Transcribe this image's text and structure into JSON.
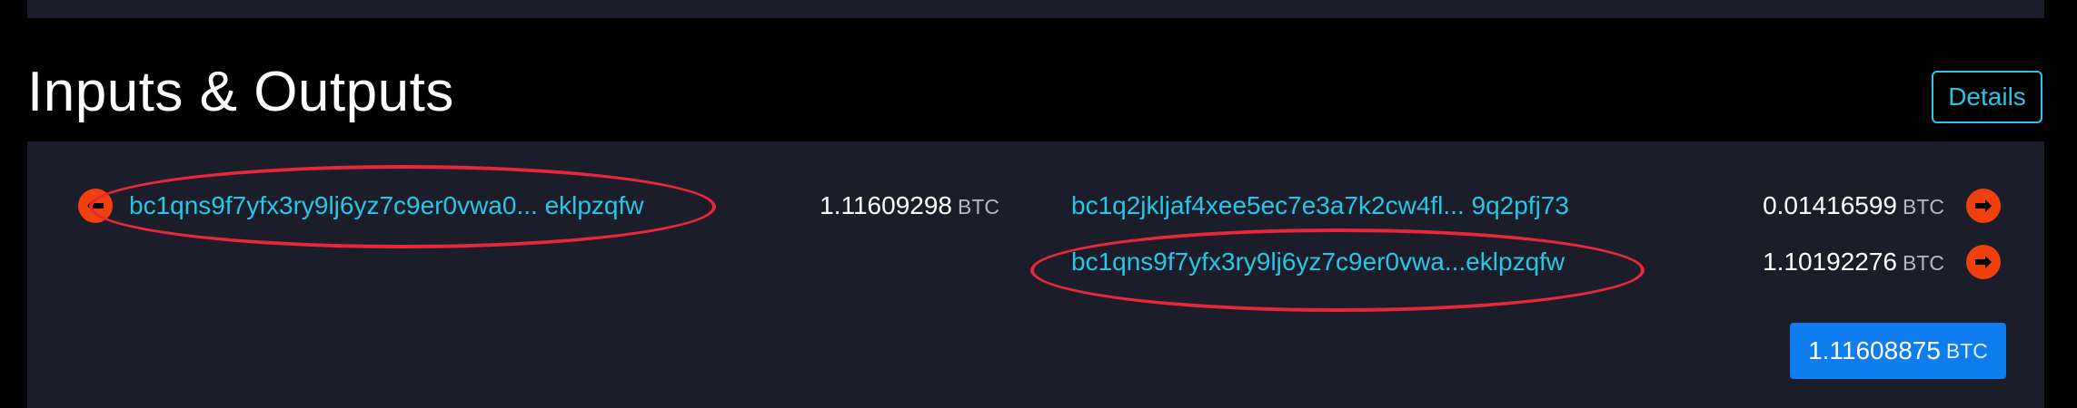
{
  "section": {
    "title": "Inputs & Outputs",
    "details_label": "Details"
  },
  "inputs": [
    {
      "address": "bc1qns9f7yfx3ry9lj6yz7c9er0vwa0... eklpzqfw",
      "amount": "1.11609298",
      "unit": "BTC",
      "icon": "arrow-left-circle-icon"
    }
  ],
  "outputs": [
    {
      "address": "bc1q2jkljaf4xee5ec7e3a7k2cw4fl... 9q2pfj73",
      "amount": "0.01416599",
      "unit": "BTC",
      "icon": "arrow-right-circle-icon"
    },
    {
      "address": "bc1qns9f7yfx3ry9lj6yz7c9er0vwa...eklpzqfw",
      "amount": "1.10192276",
      "unit": "BTC",
      "icon": "arrow-right-circle-icon"
    }
  ],
  "total": {
    "amount": "1.11608875",
    "unit": "BTC"
  },
  "colors": {
    "background": "#000000",
    "panel": "#1b1e2a",
    "link": "#27c6e6",
    "arrow": "#f0400e",
    "annotation": "#e8283a",
    "total_badge": "#0f7cf0"
  }
}
